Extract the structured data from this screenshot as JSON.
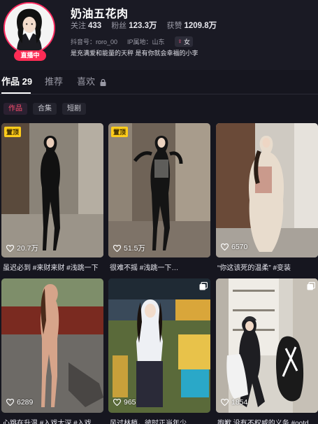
{
  "profile": {
    "name": "奶油五花肉",
    "live_badge": "直播中",
    "stats": [
      {
        "label": "关注",
        "value": "433"
      },
      {
        "label": "粉丝",
        "value": "123.3万"
      },
      {
        "label": "获赞",
        "value": "1209.8万"
      }
    ],
    "douyin_id": "抖音号：roro_00",
    "ip": "IP属地：山东",
    "gender": "女",
    "bio": "是充满爱和能量的天秤 是有你就会幸福的小李"
  },
  "tabs": {
    "works_label": "作品",
    "works_count": "29",
    "recommend_label": "推荐",
    "likes_label": "喜欢"
  },
  "filters": [
    "作品",
    "合集",
    "短剧"
  ],
  "videos": [
    {
      "pinned": "置顶",
      "likes": "20.7万",
      "caption": "虽迟必到 #来财来财 #浅跳一下"
    },
    {
      "pinned": "置顶",
      "likes": "51.5万",
      "caption": "很难不摇 #浅跳一下…"
    },
    {
      "likes": "6570",
      "caption": "“你这该死的温柔” #变装"
    },
    {
      "likes": "6289",
      "caption": "心跳在升温 #入戏太深 #入戏…"
    },
    {
      "likes": "965",
      "caption": "风过林梢，彼时正当年少"
    },
    {
      "likes": "1854",
      "caption": "抱歉 没有不权威的义务 #ootd…"
    }
  ],
  "colors": {
    "accent": "#fe2c55",
    "pinned": "#ffcc1a",
    "background": "#16161f"
  }
}
